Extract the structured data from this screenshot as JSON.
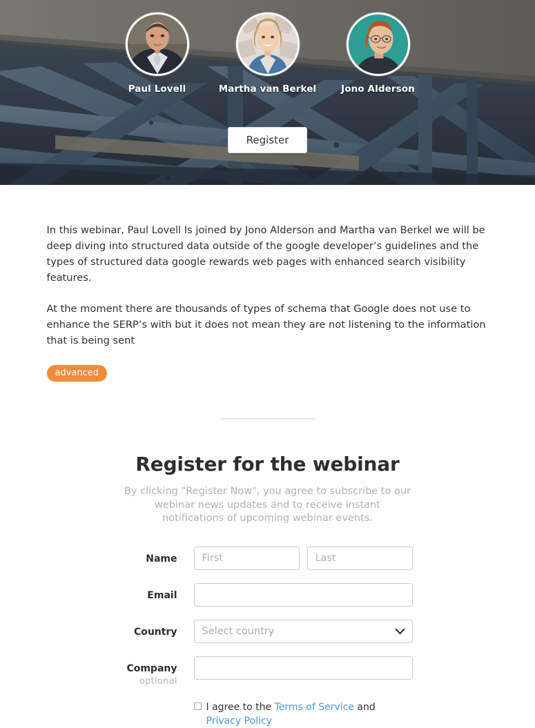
{
  "hero": {
    "speakers": [
      {
        "name": "Paul Lovell",
        "avatar_icon": "avatar-paul-lovell"
      },
      {
        "name": "Martha van Berkel",
        "avatar_icon": "avatar-martha-van-berkel"
      },
      {
        "name": "Jono Alderson",
        "avatar_icon": "avatar-jono-alderson"
      }
    ],
    "register_label": "Register",
    "background_icon": "steel-scaffolding-photo"
  },
  "article": {
    "paragraphs": [
      "In this webinar, Paul Lovell Is joined by Jono Alderson and Martha van Berkel we will be deep diving into structured data outside of the google developer’s guidelines and the types of structured data google rewards web pages with enhanced search visibility features.",
      " At the moment there are thousands of types of schema that Google does not use to enhance the SERP’s with but it does not mean they are not listening to the information that is being sent"
    ],
    "badge": "advanced",
    "badge_color": "#ef8c3c"
  },
  "form": {
    "title": "Register for the webinar",
    "subtitle": "By clicking \"Register Now\", you agree to subscribe to our webinar news updates and to receive instant notifications of upcoming webinar events.",
    "rows": {
      "name": {
        "label": "Name",
        "first_placeholder": "First",
        "first_value": "",
        "last_placeholder": "Last",
        "last_value": ""
      },
      "email": {
        "label": "Email",
        "placeholder": "",
        "value": ""
      },
      "country": {
        "label": "Country",
        "selected": "Select country",
        "chevron_icon": "chevron-down-icon"
      },
      "company": {
        "label": "Company",
        "sublabel": "optional",
        "placeholder": "",
        "value": ""
      }
    },
    "terms": {
      "checked": false,
      "text_before": "I agree to the ",
      "terms_link": "Terms of Service",
      "text_middle": " and ",
      "privacy_link": "Privacy Policy",
      "link_color": "#4e97d9"
    }
  }
}
